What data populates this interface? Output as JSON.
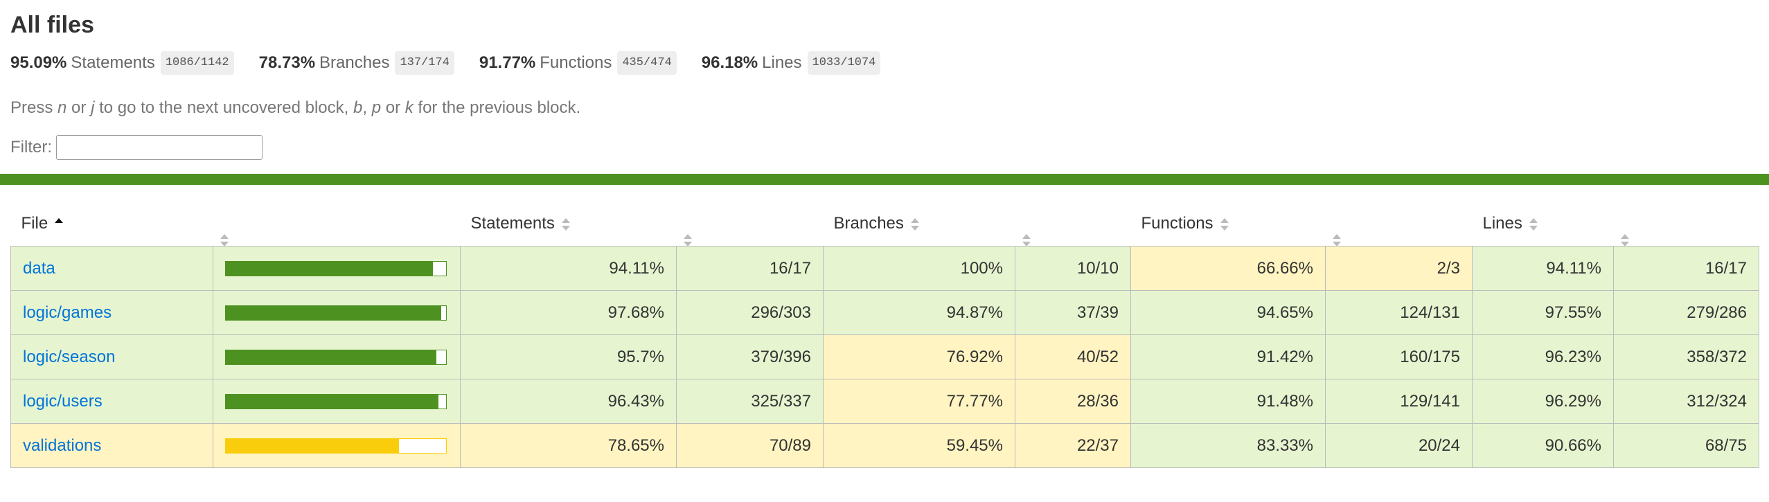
{
  "page": {
    "title": "All files"
  },
  "summary": [
    {
      "pct": "95.09%",
      "label": "Statements",
      "frac": "1086/1142"
    },
    {
      "pct": "78.73%",
      "label": "Branches",
      "frac": "137/174"
    },
    {
      "pct": "91.77%",
      "label": "Functions",
      "frac": "435/474"
    },
    {
      "pct": "96.18%",
      "label": "Lines",
      "frac": "1033/1074"
    }
  ],
  "hint": {
    "p1": "Press ",
    "k1": "n",
    "p2": " or ",
    "k2": "j",
    "p3": " to go to the next uncovered block, ",
    "k3": "b",
    "p4": ", ",
    "k4": "p",
    "p5": " or ",
    "k5": "k",
    "p6": " for the previous block."
  },
  "filter": {
    "label": "Filter:",
    "value": ""
  },
  "colors": {
    "high_bg": "#e6f5d0",
    "medium_bg": "#fff4c2",
    "bar_high": "#4d9221",
    "bar_medium": "#f9cd0b",
    "link": "#0074d9"
  },
  "table": {
    "headers": {
      "file": "File",
      "statements": "Statements",
      "branches": "Branches",
      "functions": "Functions",
      "lines": "Lines"
    },
    "rows": [
      {
        "file": "data",
        "level": "high",
        "coverage_pct": 94.11,
        "stmt_pct": "94.11%",
        "stmt_frac": "16/17",
        "stmt_level": "high",
        "br_pct": "100%",
        "br_frac": "10/10",
        "br_level": "high",
        "fn_pct": "66.66%",
        "fn_frac": "2/3",
        "fn_level": "medium",
        "ln_pct": "94.11%",
        "ln_frac": "16/17",
        "ln_level": "high"
      },
      {
        "file": "logic/games",
        "level": "high",
        "coverage_pct": 97.68,
        "stmt_pct": "97.68%",
        "stmt_frac": "296/303",
        "stmt_level": "high",
        "br_pct": "94.87%",
        "br_frac": "37/39",
        "br_level": "high",
        "fn_pct": "94.65%",
        "fn_frac": "124/131",
        "fn_level": "high",
        "ln_pct": "97.55%",
        "ln_frac": "279/286",
        "ln_level": "high"
      },
      {
        "file": "logic/season",
        "level": "high",
        "coverage_pct": 95.7,
        "stmt_pct": "95.7%",
        "stmt_frac": "379/396",
        "stmt_level": "high",
        "br_pct": "76.92%",
        "br_frac": "40/52",
        "br_level": "medium",
        "fn_pct": "91.42%",
        "fn_frac": "160/175",
        "fn_level": "high",
        "ln_pct": "96.23%",
        "ln_frac": "358/372",
        "ln_level": "high"
      },
      {
        "file": "logic/users",
        "level": "high",
        "coverage_pct": 96.43,
        "stmt_pct": "96.43%",
        "stmt_frac": "325/337",
        "stmt_level": "high",
        "br_pct": "77.77%",
        "br_frac": "28/36",
        "br_level": "medium",
        "fn_pct": "91.48%",
        "fn_frac": "129/141",
        "fn_level": "high",
        "ln_pct": "96.29%",
        "ln_frac": "312/324",
        "ln_level": "high"
      },
      {
        "file": "validations",
        "level": "medium",
        "coverage_pct": 78.65,
        "stmt_pct": "78.65%",
        "stmt_frac": "70/89",
        "stmt_level": "medium",
        "br_pct": "59.45%",
        "br_frac": "22/37",
        "br_level": "medium",
        "fn_pct": "83.33%",
        "fn_frac": "20/24",
        "fn_level": "high",
        "ln_pct": "90.66%",
        "ln_frac": "68/75",
        "ln_level": "high"
      }
    ]
  }
}
